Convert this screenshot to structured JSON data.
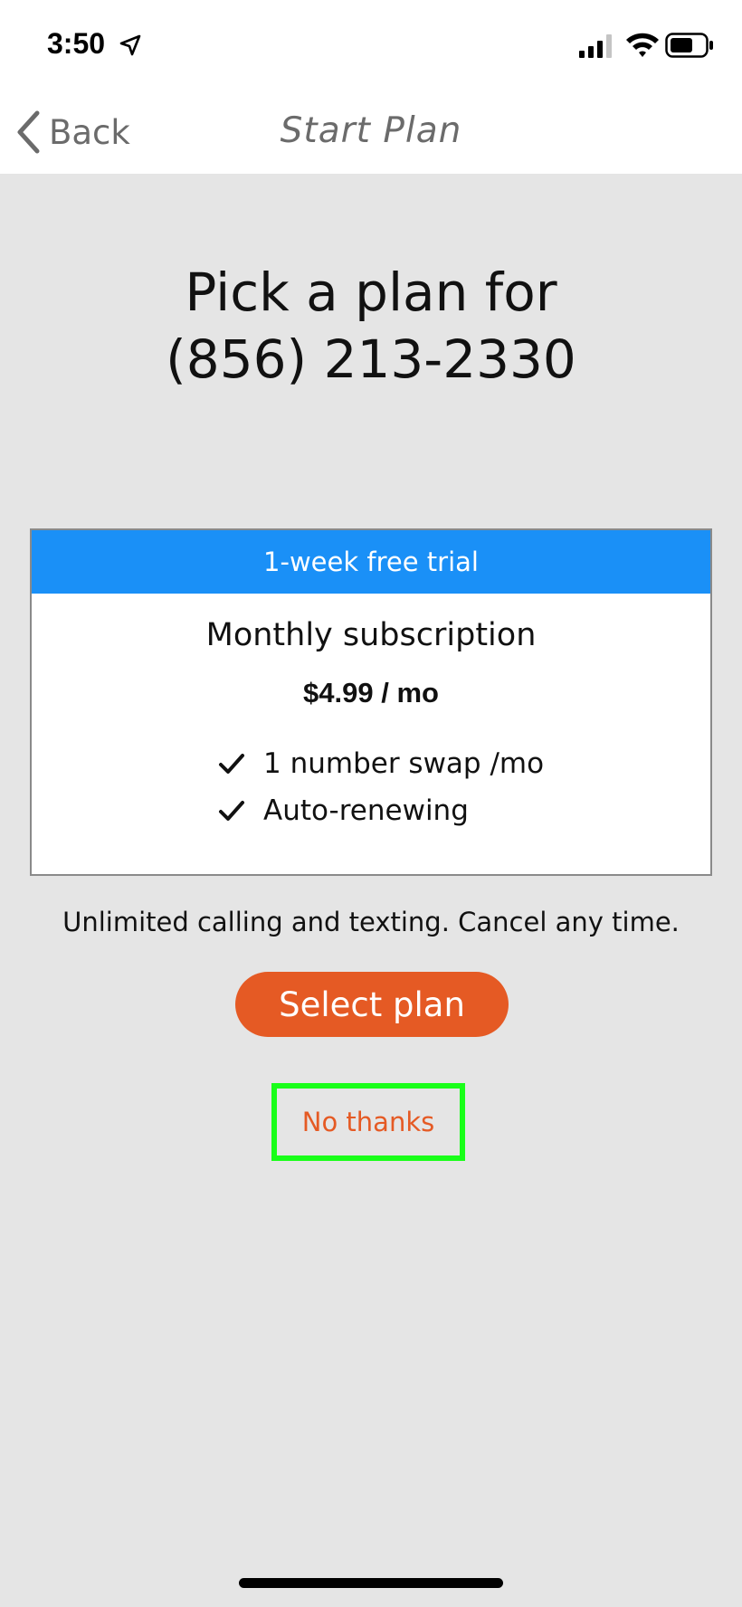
{
  "status_bar": {
    "time": "3:50"
  },
  "nav": {
    "back_label": "Back",
    "title": "Start Plan"
  },
  "heading": {
    "line1": "Pick a plan for",
    "line2": "(856) 213-2330"
  },
  "plan": {
    "trial_label": "1-week free trial",
    "name": "Monthly subscription",
    "price": "$4.99 / mo",
    "features": [
      "1 number swap /mo",
      "Auto-renewing"
    ]
  },
  "info_text": "Unlimited calling and texting. Cancel any time.",
  "buttons": {
    "select_plan": "Select plan",
    "no_thanks": "No thanks"
  },
  "colors": {
    "accent_orange": "#e55a24",
    "trial_blue": "#1a90f7",
    "highlight_green": "#19ff19",
    "background": "#e5e5e5"
  }
}
